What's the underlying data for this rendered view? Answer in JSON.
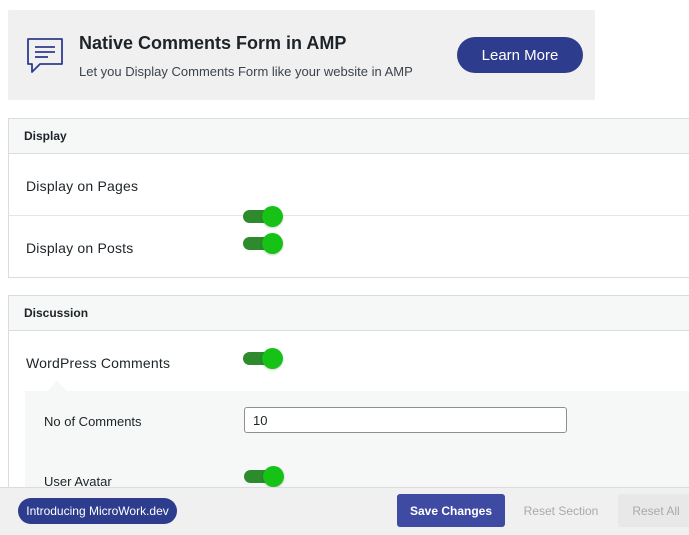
{
  "promo": {
    "title": "Native Comments Form in AMP",
    "subtitle": "Let you Display Comments Form like your website in AMP",
    "button_label": "Learn More",
    "icon": "chat-bubble-icon",
    "accent_color": "#2e3c8e"
  },
  "display_section": {
    "heading": "Display",
    "rows": [
      {
        "label": "Display on Pages",
        "enabled": true
      },
      {
        "label": "Display on Posts",
        "enabled": true
      }
    ]
  },
  "discussion_section": {
    "heading": "Discussion",
    "wordpress_comments": {
      "label": "WordPress Comments",
      "enabled": true
    },
    "no_of_comments": {
      "label": "No of Comments",
      "value": "10"
    },
    "user_avatar": {
      "label": "User Avatar",
      "enabled": true
    }
  },
  "footer": {
    "intro_label": "Introducing MicroWork.dev",
    "save_label": "Save Changes",
    "reset_section_label": "Reset Section",
    "reset_all_label": "Reset All"
  },
  "colors": {
    "toggle_on_track": "#2d8a2d",
    "toggle_on_knob": "#15c215",
    "primary_button": "#3f4ba3"
  }
}
